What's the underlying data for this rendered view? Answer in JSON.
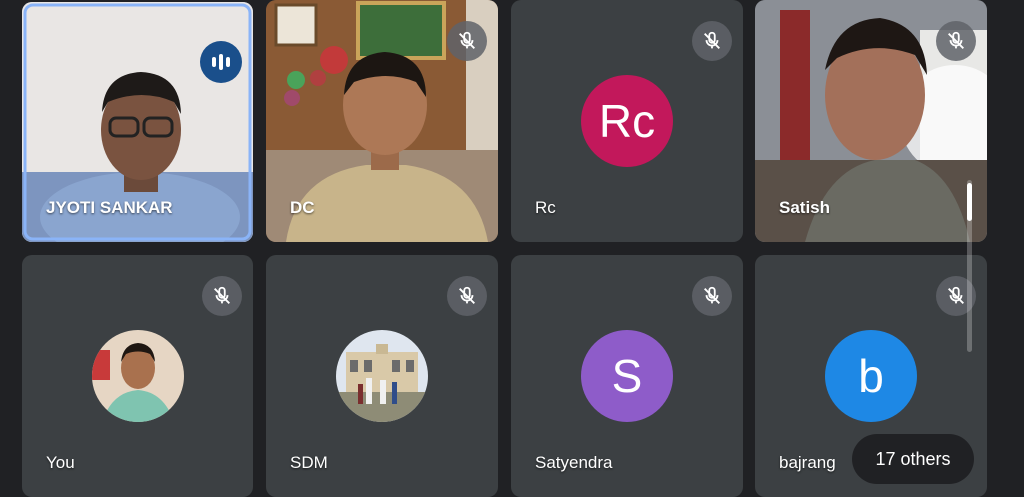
{
  "participants": [
    {
      "name": "JYOTI SANKAR",
      "type": "video",
      "speaking": true
    },
    {
      "name": "DC",
      "type": "video",
      "muted": true
    },
    {
      "name": "Rc",
      "type": "letter",
      "initials": "Rc",
      "avatar_color": "#c2185b",
      "muted": true
    },
    {
      "name": "Satish",
      "type": "video",
      "muted": true
    },
    {
      "name": "You",
      "type": "photo",
      "muted": true
    },
    {
      "name": "SDM",
      "type": "photo",
      "muted": true
    },
    {
      "name": "Satyendra",
      "type": "letter",
      "initials": "S",
      "avatar_color": "#8e5cc9",
      "muted": true
    },
    {
      "name": "bajrang",
      "type": "letter",
      "initials": "b",
      "avatar_color": "#1e88e5",
      "muted": true
    }
  ],
  "others_label": "17 others",
  "icons": {
    "mute": "mic-off-icon",
    "speaking": "audio-level-icon"
  },
  "colors": {
    "background": "#202124",
    "tile": "#3c4043",
    "active_border": "#8ab4f8"
  }
}
